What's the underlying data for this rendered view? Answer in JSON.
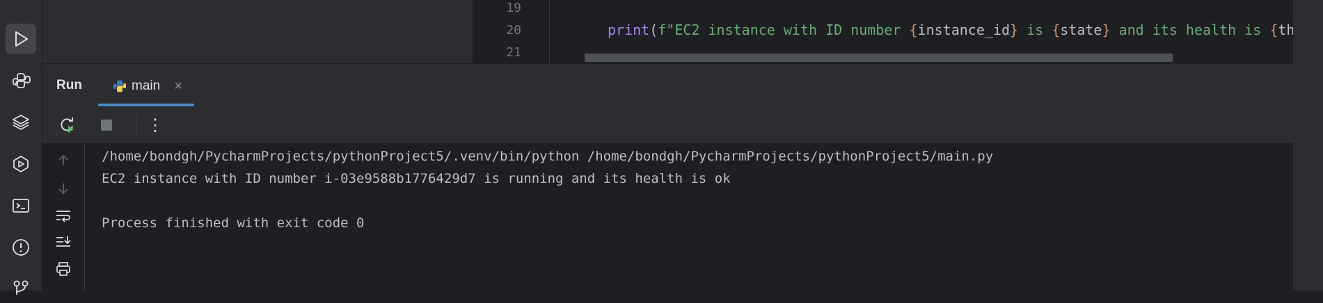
{
  "editor": {
    "line_numbers": [
      "19",
      "20",
      "21"
    ],
    "code": {
      "fn": "print",
      "open_paren": "(",
      "prefix": "f\"EC2 instance with ID number ",
      "brace1_open": "{",
      "var1": "instance_id",
      "brace1_close": "}",
      "mid1": " is ",
      "brace2_open": "{",
      "var2": "state",
      "brace2_close": "}",
      "mid2": " and its health is ",
      "brace3_open": "{",
      "tail": "th"
    }
  },
  "run_panel": {
    "title": "Run",
    "tab_label": "main",
    "tab_close_glyph": "×",
    "more_glyph": "⋮"
  },
  "console": {
    "lines": [
      "/home/bondgh/PycharmProjects/pythonProject5/.venv/bin/python /home/bondgh/PycharmProjects/pythonProject5/main.py",
      "EC2 instance with ID number i-03e9588b1776429d7 is running and its health is ok",
      "",
      "Process finished with exit code 0"
    ]
  },
  "icons": {
    "activity_bar": [
      "run-icon",
      "python-console-icon",
      "layers-icon",
      "services-icon",
      "terminal-icon",
      "problems-icon",
      "git-icon"
    ],
    "toolbar": [
      "rerun-icon",
      "stop-icon",
      "more-icon"
    ],
    "console_gutter": [
      "scroll-up-icon",
      "scroll-down-icon",
      "soft-wrap-icon",
      "scroll-to-end-icon",
      "print-icon"
    ]
  },
  "colors": {
    "accent": "#4a88c7",
    "run_green": "#5fb865",
    "keyword_purple": "#a984f0",
    "string_green": "#6aab73",
    "brace_orange": "#cf8e6d"
  }
}
